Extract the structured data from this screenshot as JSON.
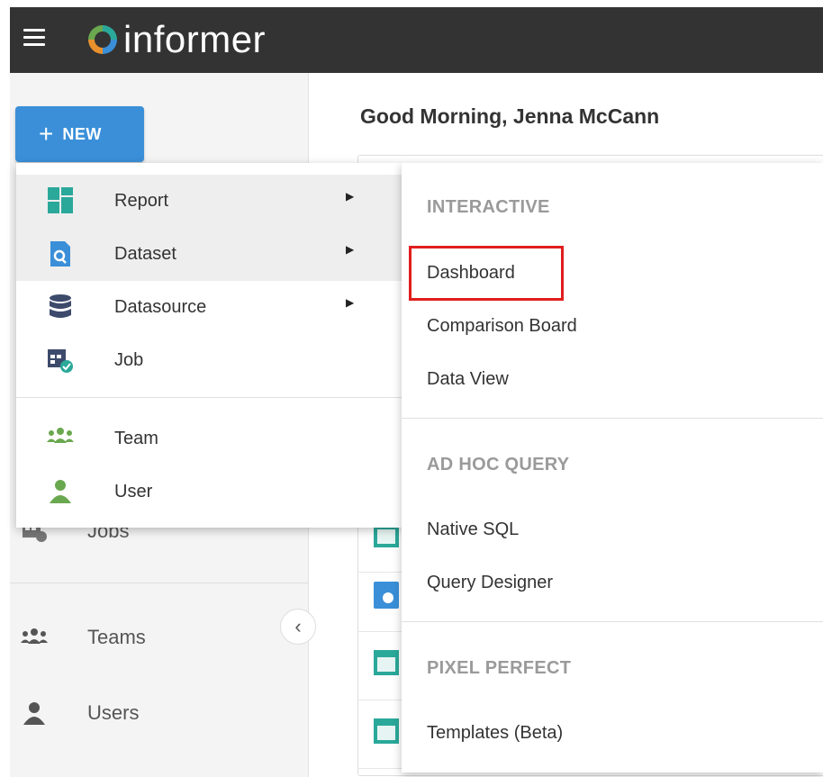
{
  "app": {
    "logo_text": "informer"
  },
  "sidebar": {
    "new_button": {
      "plus": "+",
      "label": "NEW"
    },
    "items": [
      {
        "label": "Jobs",
        "icon": "job-icon"
      },
      {
        "label": "Teams",
        "icon": "team-icon"
      },
      {
        "label": "Users",
        "icon": "user-icon"
      }
    ],
    "collapse_glyph": "‹"
  },
  "main": {
    "greeting": "Good Morning, Jenna McCann"
  },
  "new_menu": {
    "items": [
      {
        "label": "Report",
        "icon": "report-icon",
        "has_submenu": true
      },
      {
        "label": "Dataset",
        "icon": "dataset-icon",
        "has_submenu": true
      },
      {
        "label": "Datasource",
        "icon": "datasource-icon",
        "has_submenu": true
      },
      {
        "label": "Job",
        "icon": "job-icon",
        "has_submenu": false
      },
      {
        "label": "Team",
        "icon": "team-icon",
        "has_submenu": false
      },
      {
        "label": "User",
        "icon": "user-icon",
        "has_submenu": false
      }
    ],
    "arrow_glyph": "▶"
  },
  "submenu": {
    "sections": [
      {
        "heading": "INTERACTIVE",
        "items": [
          "Dashboard",
          "Comparison Board",
          "Data View"
        ]
      },
      {
        "heading": "AD HOC QUERY",
        "items": [
          "Native SQL",
          "Query Designer"
        ]
      },
      {
        "heading": "PIXEL PERFECT",
        "items": [
          "Templates (Beta)"
        ]
      }
    ]
  },
  "colors": {
    "topbar": "#333333",
    "new_button": "#3a8fd8",
    "icon_teal": "#2aa89a",
    "icon_blue": "#3a8fd8",
    "icon_navy": "#3d4a6b",
    "icon_green": "#6aa84f",
    "highlight": "#e11d1d"
  }
}
